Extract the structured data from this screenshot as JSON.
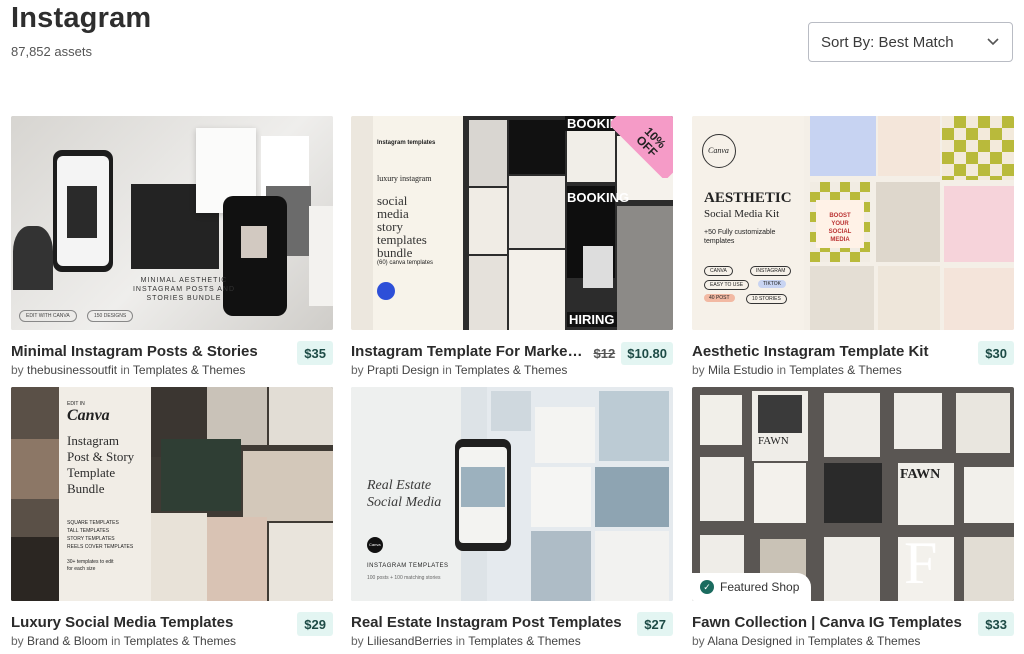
{
  "header": {
    "title": "Instagram",
    "count": "87,852 assets"
  },
  "sort": {
    "label": "Sort By: Best Match"
  },
  "by_word": "by",
  "in_word": "in",
  "cards": [
    {
      "title": "Minimal Instagram Posts & Stories",
      "author": "thebusinessoutfit",
      "category": "Templates & Themes",
      "price": "$35",
      "thumb_text": [
        "MINIMAL AESTHETIC",
        "INSTAGRAM POSTS AND",
        "STORIES BUNDLE",
        "EDIT WITH CANVA",
        "150 DESIGNS"
      ]
    },
    {
      "title": "Instagram Template For Marke…",
      "author": "Prapti Design",
      "category": "Templates & Themes",
      "old_price": "$12",
      "price": "$10.80",
      "sale": "10% OFF",
      "thumb_text": [
        "Instagram templates",
        "luxury instagram",
        "social",
        "media",
        "story",
        "templates",
        "bundle",
        "(60) canva templates",
        "BOOKING",
        "HIRING"
      ]
    },
    {
      "title": "Aesthetic Instagram Template Kit",
      "author": "Mila Estudio",
      "category": "Templates & Themes",
      "price": "$30",
      "thumb_text": [
        "Canva",
        "AESTHETIC",
        "Social Media Kit",
        "+50 Fully customizable",
        "templates",
        "CANVA",
        "INSTAGRAM",
        "EASY TO USE",
        "TIKTOK",
        "40 POST",
        "10 STORIES",
        "BOOST YOUR SOCIAL MEDIA"
      ]
    },
    {
      "title": "Luxury Social Media Templates",
      "author": "Brand & Bloom",
      "category": "Templates & Themes",
      "price": "$29",
      "thumb_text": [
        "EDIT IN",
        "Canva",
        "Instagram",
        "Post & Story",
        "Template",
        "Bundle",
        "SQUARE TEMPLATES",
        "TALL TEMPLATES",
        "STORY TEMPLATES",
        "REELS COVER TEMPLATES",
        "30+ templates to edit",
        "for each size"
      ]
    },
    {
      "title": "Real Estate Instagram Post Templates",
      "author": "LiliesandBerries",
      "category": "Templates & Themes",
      "price": "$27",
      "thumb_text": [
        "Real Estate",
        "Social Media",
        "Canva",
        "INSTAGRAM TEMPLATES",
        "100 posts + 100 matching stories"
      ]
    },
    {
      "title": "Fawn Collection | Canva IG Templates",
      "author": "Alana Designed",
      "category": "Templates & Themes",
      "price": "$33",
      "featured": "Featured Shop",
      "thumb_text": [
        "FAWN",
        "FAWN",
        "F"
      ]
    }
  ]
}
